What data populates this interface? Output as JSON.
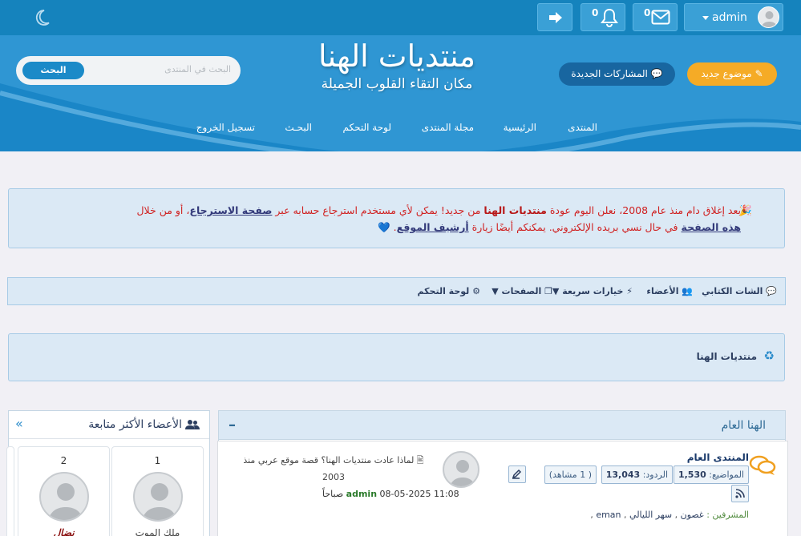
{
  "topbar": {
    "logout_icon": "logout-icon",
    "notifications_count": "0",
    "messages_count": "0",
    "username": "admin",
    "theme_icon": "moon-icon"
  },
  "header": {
    "logo_title": "منتديات الهنا",
    "logo_subtitle": "مكان التقاء القلوب الجميلة",
    "search_button": "البحث",
    "search_placeholder": "البحث في المنتدى",
    "new_posts_button": "المشاركات الجديدة",
    "new_topic_button": "موضوع جديد",
    "nav": [
      "المنتدى",
      "الرئيسية",
      "مجلة المنتدى",
      "لوحة التحكم",
      "البحـث",
      "تسجيل الخروج"
    ]
  },
  "announcement": {
    "text_1": "بعد إغلاق دام منذ عام 2008، نعلن اليوم عودة ",
    "forum_name": "منتديات الهنا",
    "text_2": " من جديد! يمكن لأي مستخدم استرجاع حسابه عبر ",
    "link_recovery": "صفحة الاسترجاع",
    "text_3": "، أو من خلال ",
    "link_this_page": "هذه الصفحة",
    "text_4": " في حال نسي بريده الإلكتروني. يمكنكم أيضًا زيارة ",
    "link_archive": "أرشيف الموقع",
    "text_5": ". "
  },
  "toolbar": {
    "chat": "الشات الكتابي",
    "members": "الأعضاء",
    "quick_options": "خيارات سريعة",
    "pages": "الصفحات",
    "control_panel": "لوحة التحكم"
  },
  "breadcrumb": {
    "label": "منتديات الهنا"
  },
  "category": {
    "title": "الهنا العام",
    "forum": {
      "name": "المنتدى العام",
      "topics_label": "المواضيع:",
      "topics": "1,530",
      "replies_label": "الردود:",
      "replies": "13,043",
      "viewers": "( 1 مشاهد)",
      "moderators_label": "المشرفين :",
      "moderators": [
        "غصون",
        "سهر الليالي",
        "eman"
      ],
      "last_post_title": "لماذا عادت منتديات الهنا؟ قصة موقع عربي منذ 2003",
      "last_post_user": "admin",
      "last_post_date": "08-05-2025 11:08 صباحاً"
    }
  },
  "sidebar": {
    "title": "الأعضاء الأكثر متابعة",
    "members": [
      {
        "rank": "1",
        "name": "ملك الموت"
      },
      {
        "rank": "2",
        "name": "نضال"
      }
    ]
  }
}
